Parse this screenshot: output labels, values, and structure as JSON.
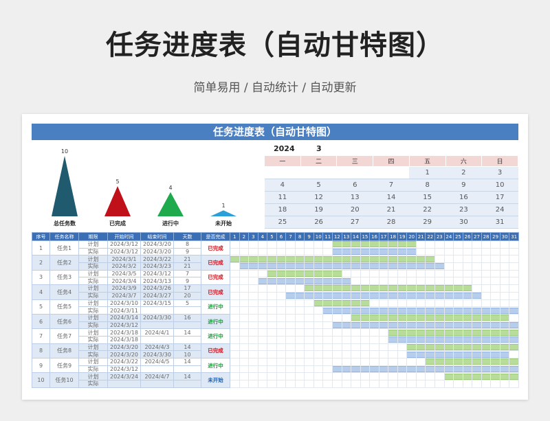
{
  "header": {
    "title": "任务进度表（自动甘特图）",
    "subtitle": "简单易用 / 自动统计 / 自动更新"
  },
  "sheet": {
    "banner": "任务进度表（自动甘特图）"
  },
  "colors": {
    "total": "#1f5a6e",
    "done": "#c0101a",
    "doing": "#1faa4e",
    "todo": "#2a9fd8",
    "accent": "#4a7fc1"
  },
  "summary": [
    {
      "label": "总任务数",
      "value": 10
    },
    {
      "label": "已完成",
      "value": 5
    },
    {
      "label": "进行中",
      "value": 4
    },
    {
      "label": "未开始",
      "value": 1
    }
  ],
  "calendar": {
    "year": "2024",
    "month": "3",
    "weekdays": [
      "一",
      "二",
      "三",
      "四",
      "五",
      "六",
      "日"
    ],
    "weeks": [
      [
        "",
        "",
        "",
        "",
        "1",
        "2",
        "3"
      ],
      [
        "4",
        "5",
        "6",
        "7",
        "8",
        "9",
        "10"
      ],
      [
        "11",
        "12",
        "13",
        "14",
        "15",
        "16",
        "17"
      ],
      [
        "18",
        "19",
        "20",
        "21",
        "22",
        "23",
        "24"
      ],
      [
        "25",
        "26",
        "27",
        "28",
        "29",
        "30",
        "31"
      ]
    ]
  },
  "gantt": {
    "headers": [
      "序号",
      "任务名称",
      "期限",
      "开始时间",
      "结束时间",
      "天数",
      "是否完成"
    ],
    "days": [
      "1",
      "2",
      "3",
      "4",
      "5",
      "6",
      "7",
      "8",
      "9",
      "10",
      "11",
      "12",
      "13",
      "14",
      "15",
      "16",
      "17",
      "18",
      "19",
      "20",
      "21",
      "22",
      "23",
      "24",
      "25",
      "26",
      "27",
      "28",
      "29",
      "30",
      "31"
    ],
    "plan_label": "计划",
    "actual_label": "实际",
    "tasks": [
      {
        "no": "1",
        "name": "任务1",
        "plan": {
          "start": "2024/3/12",
          "end": "2024/3/20",
          "days": "8"
        },
        "actual": {
          "start": "2024/3/12",
          "end": "2024/3/20",
          "days": "9"
        },
        "status": "已完成",
        "status_color": "#d0101a"
      },
      {
        "no": "2",
        "name": "任务2",
        "plan": {
          "start": "2024/3/1",
          "end": "2024/3/22",
          "days": "21"
        },
        "actual": {
          "start": "2024/3/2",
          "end": "2024/3/23",
          "days": "21"
        },
        "status": "已完成",
        "status_color": "#d0101a"
      },
      {
        "no": "3",
        "name": "任务3",
        "plan": {
          "start": "2024/3/5",
          "end": "2024/3/12",
          "days": "7"
        },
        "actual": {
          "start": "2024/3/4",
          "end": "2024/3/13",
          "days": "9"
        },
        "status": "已完成",
        "status_color": "#d0101a"
      },
      {
        "no": "4",
        "name": "任务4",
        "plan": {
          "start": "2024/3/9",
          "end": "2024/3/26",
          "days": "17"
        },
        "actual": {
          "start": "2024/3/7",
          "end": "2024/3/27",
          "days": "20"
        },
        "status": "已完成",
        "status_color": "#d0101a"
      },
      {
        "no": "5",
        "name": "任务5",
        "plan": {
          "start": "2024/3/10",
          "end": "2024/3/15",
          "days": "5"
        },
        "actual": {
          "start": "2024/3/11",
          "end": "",
          "days": ""
        },
        "status": "进行中",
        "status_color": "#1a9a3a"
      },
      {
        "no": "6",
        "name": "任务6",
        "plan": {
          "start": "2024/3/14",
          "end": "2024/3/30",
          "days": "16"
        },
        "actual": {
          "start": "2024/3/12",
          "end": "",
          "days": ""
        },
        "status": "进行中",
        "status_color": "#1a9a3a"
      },
      {
        "no": "7",
        "name": "任务7",
        "plan": {
          "start": "2024/3/18",
          "end": "2024/4/1",
          "days": "14"
        },
        "actual": {
          "start": "2024/3/18",
          "end": "",
          "days": ""
        },
        "status": "进行中",
        "status_color": "#1a9a3a"
      },
      {
        "no": "8",
        "name": "任务8",
        "plan": {
          "start": "2024/3/20",
          "end": "2024/4/3",
          "days": "14"
        },
        "actual": {
          "start": "2024/3/20",
          "end": "2024/3/30",
          "days": "10"
        },
        "status": "已完成",
        "status_color": "#d0101a"
      },
      {
        "no": "9",
        "name": "任务9",
        "plan": {
          "start": "2024/3/22",
          "end": "2024/4/5",
          "days": "14"
        },
        "actual": {
          "start": "2024/3/12",
          "end": "",
          "days": ""
        },
        "status": "进行中",
        "status_color": "#1a9a3a"
      },
      {
        "no": "10",
        "name": "任务10",
        "plan": {
          "start": "2024/3/24",
          "end": "2024/4/7",
          "days": "14"
        },
        "actual": {
          "start": "",
          "end": "",
          "days": ""
        },
        "status": "未开始",
        "status_color": "#1a5fb0"
      }
    ]
  }
}
